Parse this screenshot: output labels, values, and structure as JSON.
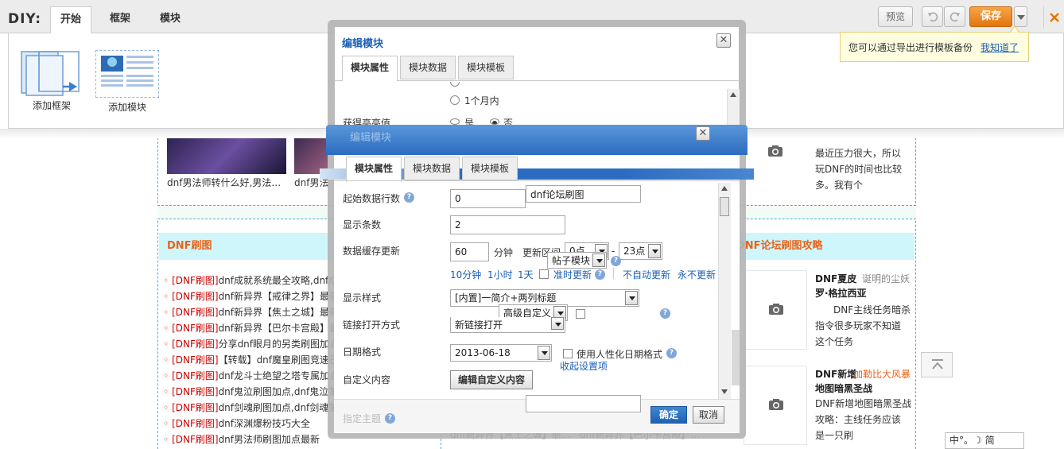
{
  "topbar": {
    "diy_label": "DIY:",
    "tabs": [
      "开始",
      "框架",
      "模块"
    ],
    "preview": "预览",
    "save": "保存",
    "tip_text": "您可以通过导出进行模板备份",
    "tip_link": "我知道了"
  },
  "tools": {
    "add_frame": "添加框架",
    "add_module": "添加模块"
  },
  "page": {
    "thumb_captions": [
      "dnf男法师转什么好,男法…",
      "dnf男法"
    ],
    "left_section_title": "DNF刷图",
    "right_section_title": "DNF论坛刷图攻略",
    "list": [
      {
        "tag": "[DNF刷图]",
        "text": "dnf成就系统最全攻略,dnf成"
      },
      {
        "tag": "[DNF刷图]",
        "text": "dnf新异界【戒律之界】最新"
      },
      {
        "tag": "[DNF刷图]",
        "text": "dnf新异界【焦土之城】最新"
      },
      {
        "tag": "[DNF刷图]",
        "text": "dnf新异界【巴尔卡宫殿】最"
      },
      {
        "tag": "[DNF刷图]",
        "text": "分享dnf眼月的另类刷图加点"
      },
      {
        "tag": "[DNF刷图]",
        "text": "【转载】dnf魔皇刷图竞速已"
      },
      {
        "tag": "[DNF刷图]",
        "text": "dnf龙斗士绝望之塔专属加点"
      },
      {
        "tag": "[DNF刷图]",
        "text": "dnf鬼泣刷图加点,dnf鬼泣第"
      },
      {
        "tag": "[DNF刷图]",
        "text": "dnf剑魂刷图加点,dnf剑魂第"
      },
      {
        "tag": "[DNF刷图]",
        "text": "dnf深渊爆粉技巧大全"
      },
      {
        "tag": "[DNF刷图]",
        "text": "dnf男法师刷图加点最新"
      }
    ],
    "right_top_text": [
      "最近压力很大，所以",
      "玩DNF的时间也比较",
      "多。我有个"
    ],
    "right_item1": {
      "title1": "DNF夏皮",
      "author": "诞明的尘妖",
      "title2": "罗·格拉西亚",
      "lines": [
        "DNF主线任务暗杀",
        "指令很多玩家不知道",
        "这个任务"
      ]
    },
    "right_item2": {
      "title1": "DNF新增",
      "extra": "加勒比大风暴",
      "title2": "地图暗黑圣战",
      "lines": [
        "DNF新增地图暗黑圣战",
        "攻略：主线任务应该",
        "是一只刷"
      ]
    },
    "bottom_caption": "dnf新异界【焦土之城】最…   dnf新异界【巴尔卡宫殿】…",
    "ime": "中°。☽ 简"
  },
  "dialog1": {
    "title": "编辑模块",
    "tabs": [
      "模块属性",
      "模块数据",
      "模块模板"
    ],
    "radio_month": "1个月内",
    "highest_label": "获得高亮值",
    "yes": "是",
    "no": "否"
  },
  "dialog2": {
    "title": "编辑模块",
    "tabs": [
      "模块属性",
      "模块数据",
      "模块模板"
    ],
    "forum_input": "dnf论坛刷图",
    "start_rows_label": "起始数据行数",
    "start_rows_value": "0",
    "count_label": "显示条数",
    "count_value": "2",
    "cache_label": "数据缓存更新",
    "cache_value": "60",
    "minute": "分钟",
    "update_range": "更新区间",
    "range_from": "0点",
    "range_to": "23点",
    "post_module": "帖子模块",
    "quick_links": [
      "10分钟",
      "1小时",
      "1天"
    ],
    "on_time": "准时更新",
    "no_auto": "不自动更新",
    "never": "永不更新",
    "style_label": "显示样式",
    "style_value": "[内置]一简介+两列标题",
    "advanced": "高级自定义",
    "link_label": "链接打开方式",
    "link_value": "新链接打开",
    "date_label": "日期格式",
    "date_value": "2013-06-18",
    "humanize": "使用人性化日期格式",
    "collapse": "收起设置项",
    "custom_label": "自定义内容",
    "custom_btn": "编辑自定义内容",
    "extra_label": "指定主题",
    "ok": "确定",
    "cancel": "取消"
  }
}
